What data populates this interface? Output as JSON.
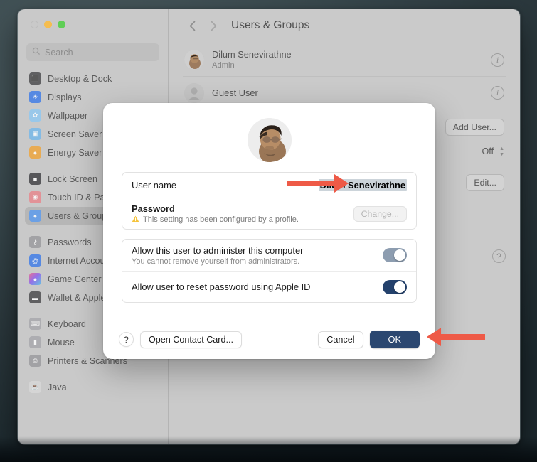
{
  "window": {
    "traffic_lights": [
      "close",
      "minimize",
      "zoom"
    ],
    "search_placeholder": "Search"
  },
  "sidebar": {
    "groups": [
      {
        "items": [
          {
            "label": "Desktop & Dock",
            "icon": "desktop-dock-icon",
            "icon_class": "ic-desktop",
            "glyph": "⬛",
            "selected": false
          },
          {
            "label": "Displays",
            "icon": "displays-icon",
            "icon_class": "ic-displays",
            "glyph": "☀",
            "selected": false
          },
          {
            "label": "Wallpaper",
            "icon": "wallpaper-icon",
            "icon_class": "ic-wall",
            "glyph": "✿",
            "selected": false
          },
          {
            "label": "Screen Saver",
            "icon": "screen-saver-icon",
            "icon_class": "ic-screen",
            "glyph": "▣",
            "selected": false
          },
          {
            "label": "Energy Saver",
            "icon": "energy-saver-icon",
            "icon_class": "ic-energy",
            "glyph": "●",
            "selected": false
          }
        ]
      },
      {
        "items": [
          {
            "label": "Lock Screen",
            "icon": "lock-screen-icon",
            "icon_class": "ic-lock",
            "glyph": "■",
            "selected": false
          },
          {
            "label": "Touch ID & Password",
            "icon": "touch-id-icon",
            "icon_class": "ic-touch",
            "glyph": "◉",
            "selected": false
          },
          {
            "label": "Users & Groups",
            "icon": "users-groups-icon",
            "icon_class": "ic-users",
            "glyph": "●",
            "selected": true
          }
        ]
      },
      {
        "items": [
          {
            "label": "Passwords",
            "icon": "passwords-icon",
            "icon_class": "ic-pass",
            "glyph": "⚷",
            "selected": false
          },
          {
            "label": "Internet Accounts",
            "icon": "internet-accounts-icon",
            "icon_class": "ic-internet",
            "glyph": "@",
            "selected": false
          },
          {
            "label": "Game Center",
            "icon": "game-center-icon",
            "icon_class": "ic-game",
            "glyph": "●",
            "selected": false
          },
          {
            "label": "Wallet & Apple Pay",
            "icon": "wallet-apple-pay-icon",
            "icon_class": "ic-wallet",
            "glyph": "▬",
            "selected": false
          }
        ]
      },
      {
        "items": [
          {
            "label": "Keyboard",
            "icon": "keyboard-icon",
            "icon_class": "ic-keyb",
            "glyph": "⌨",
            "selected": false
          },
          {
            "label": "Mouse",
            "icon": "mouse-icon",
            "icon_class": "ic-mouse",
            "glyph": "▮",
            "selected": false
          },
          {
            "label": "Printers & Scanners",
            "icon": "printers-scanners-icon",
            "icon_class": "ic-print",
            "glyph": "⎙",
            "selected": false
          }
        ]
      },
      {
        "items": [
          {
            "label": "Java",
            "icon": "java-icon",
            "icon_class": "ic-java",
            "glyph": "☕",
            "selected": false
          }
        ]
      }
    ]
  },
  "main": {
    "title": "Users & Groups",
    "back_icon": "chevron-left-icon",
    "forward_icon": "chevron-right-icon",
    "users": [
      {
        "name": "Dilum Senevirathne",
        "role": "Admin",
        "info_icon": "info-icon"
      },
      {
        "name": "Guest User",
        "role": "",
        "info_icon": "info-icon"
      }
    ],
    "add_user_label": "Add User...",
    "popup_value": "Off",
    "edit_label": "Edit...",
    "help_label": "?"
  },
  "sheet": {
    "avatar_name": "user-avatar",
    "user_name_label": "User name",
    "user_name_value": "Dilum Senevirathne",
    "password_label": "Password",
    "password_note": "This setting has been configured by a profile.",
    "warning_icon": "warning-triangle-icon",
    "change_label": "Change...",
    "admin_label": "Allow this user to administer this computer",
    "admin_note": "You cannot remove yourself from administrators.",
    "admin_toggle_state": "on",
    "appleid_label": "Allow user to reset password using Apple ID",
    "appleid_toggle_state": "on",
    "help_label": "?",
    "open_contact_card_label": "Open Contact Card...",
    "cancel_label": "Cancel",
    "ok_label": "OK"
  },
  "annotations": {
    "arrow_color": "#ee5a47",
    "arrow_to_user_name": "arrow-pointing-to-user-name",
    "arrow_to_ok": "arrow-pointing-to-ok-button"
  }
}
